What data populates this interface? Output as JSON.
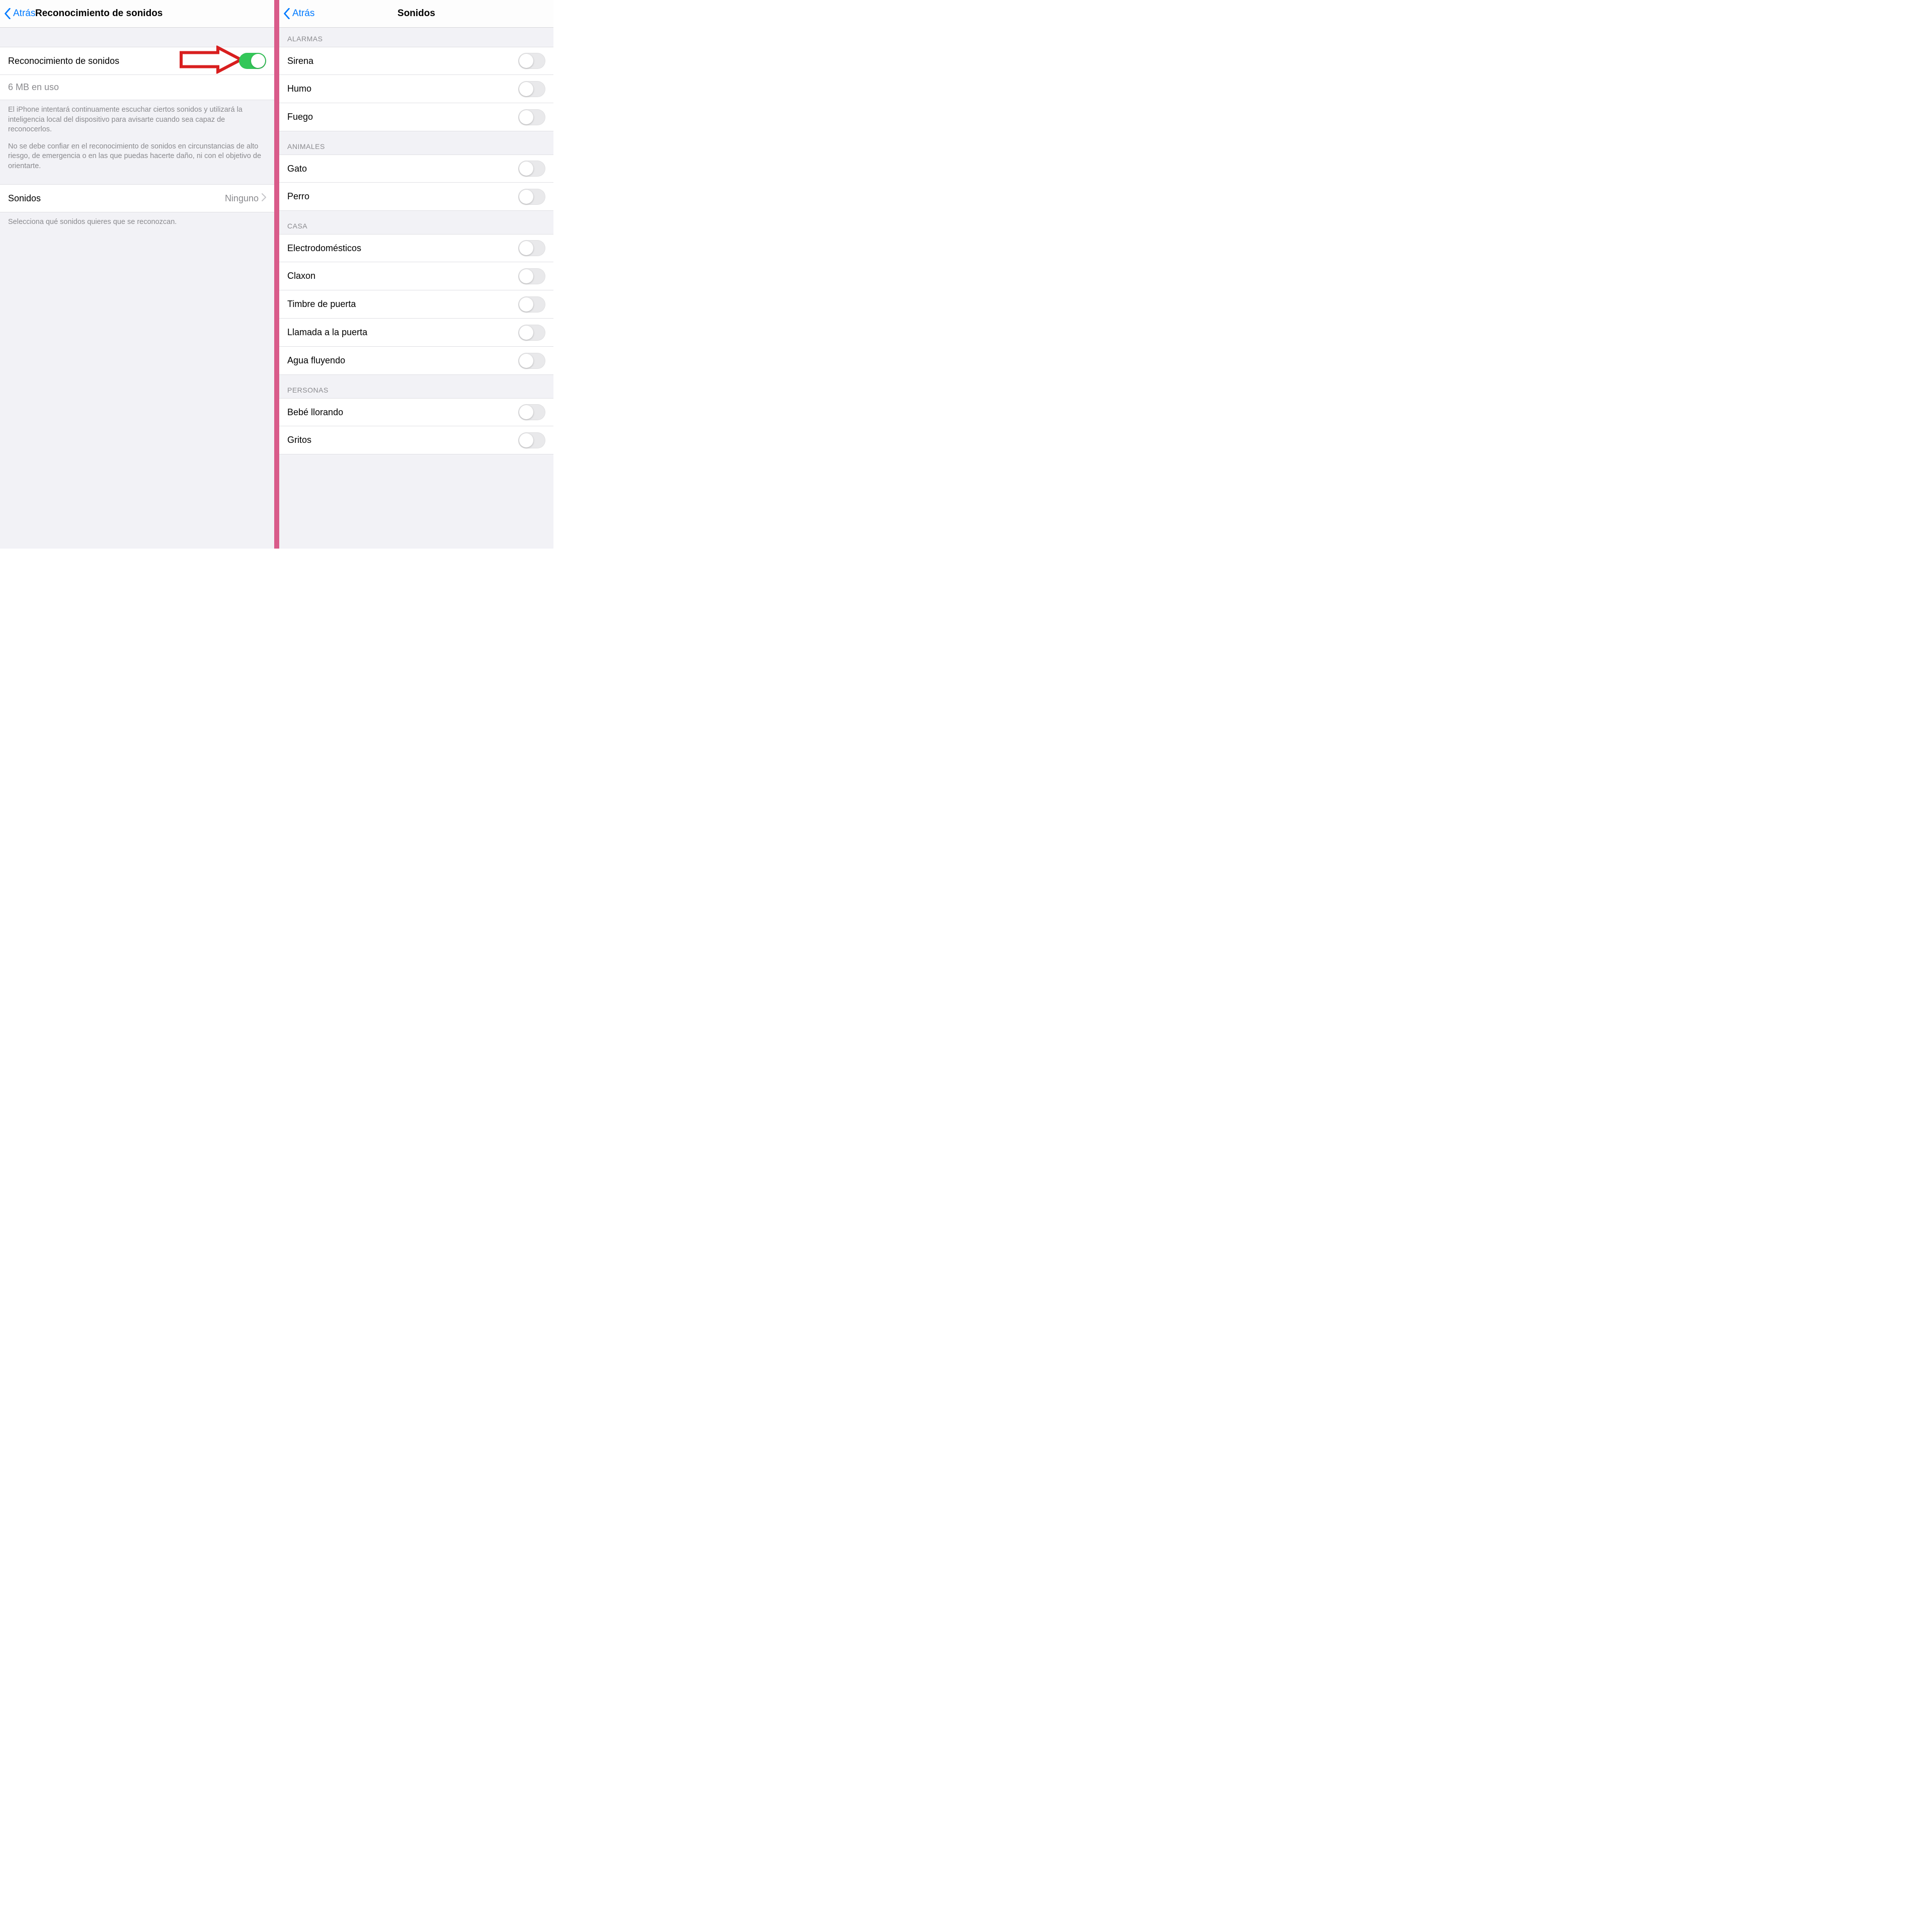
{
  "left": {
    "back": "Atrás",
    "title": "Reconocimiento de sonidos",
    "mainToggle": {
      "label": "Reconocimiento de sonidos",
      "on": true
    },
    "usage": "6 MB en uso",
    "desc1": "El iPhone intentará continuamente escuchar ciertos sonidos y utilizará la inteligencia local del dispositivo para avisarte cuando sea capaz de reconocerlos.",
    "desc2": "No se debe confiar en el reconocimiento de sonidos en circunstancias de alto riesgo, de emergencia o en las que puedas hacerte daño, ni con el objetivo de orientarte.",
    "soundsRow": {
      "label": "Sonidos",
      "value": "Ninguno"
    },
    "soundsFooter": "Selecciona qué sonidos quieres que se reconozcan."
  },
  "right": {
    "back": "Atrás",
    "title": "Sonidos",
    "groups": [
      {
        "header": "ALARMAS",
        "items": [
          "Sirena",
          "Humo",
          "Fuego"
        ]
      },
      {
        "header": "ANIMALES",
        "items": [
          "Gato",
          "Perro"
        ]
      },
      {
        "header": "CASA",
        "items": [
          "Electrodomésticos",
          "Claxon",
          "Timbre de puerta",
          "Llamada a la puerta",
          "Agua fluyendo"
        ]
      },
      {
        "header": "PERSONAS",
        "items": [
          "Bebé llorando",
          "Gritos"
        ]
      }
    ]
  },
  "colors": {
    "accent": "#007aff",
    "toggleOn": "#34c759",
    "arrow": "#d81e1e"
  }
}
